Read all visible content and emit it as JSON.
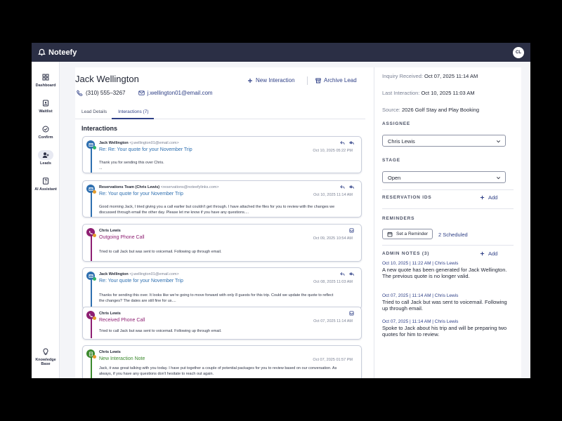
{
  "app": {
    "name": "Noteefy",
    "user_initials": "CL"
  },
  "sidebar": {
    "items": [
      {
        "label": "Dashboard",
        "icon": "grid-icon"
      },
      {
        "label": "Waitlist",
        "icon": "clipboard-icon"
      },
      {
        "label": "Confirm",
        "icon": "check-circle-icon"
      },
      {
        "label": "Leads",
        "icon": "user-plus-icon",
        "active": true
      },
      {
        "label": "AI Assistant",
        "icon": "question-book-icon"
      }
    ],
    "bottom_item": {
      "label": "Knowledge Base",
      "icon": "lightbulb-icon"
    }
  },
  "lead": {
    "name": "Jack Wellington",
    "phone": "(310) 555–3267",
    "email": "j.wellington01@email.com",
    "actions": {
      "new_interaction": "New Interaction",
      "archive_lead": "Archive Lead"
    }
  },
  "tabs": [
    {
      "label": "Lead Details",
      "active": false
    },
    {
      "label": "Interactions (7)",
      "active": true
    }
  ],
  "interactions_title": "Interactions",
  "interactions": [
    {
      "type": "email-in",
      "from_name": "Jack Wellington",
      "from_addr": "<j.wellington01@email.com>",
      "subject": "Re: Re: Your quote for your November Trip",
      "date": "Oct 10, 2025 05:22 PM",
      "body_lines": [
        "Thank you for sending this over Chris.",
        "..."
      ]
    },
    {
      "type": "email-out",
      "from_name": "Reservations Team (Chris Lewis)",
      "from_addr": "<reservations@noteefylinks.com>",
      "subject": "Re: Your quote for your November Trip",
      "date": "Oct 10, 2025 11:14 AM",
      "body_lines": [
        "Good morning Jack, I tried giving you a call earlier but couldn't get through. I have attached the files for you to review with the changes we",
        "discussed through email the other day. Please let me know if you have any questions...."
      ]
    },
    {
      "type": "call-out",
      "from_name": "Chris Lewis",
      "from_addr": "",
      "subject": "Outgoing Phone Call",
      "date": "Oct 09, 2025 10:54 AM",
      "body_lines": [
        "Tried to call Jack but was sent to voicemail. Following up through email."
      ]
    },
    {
      "type": "email-in",
      "from_name": "Jack Wellington",
      "from_addr": "<j.wellington01@email.com>",
      "subject": "Re: Your quote for your November Trip",
      "date": "Oct 08, 2025 11:03 AM",
      "body_lines": [
        "Thanks for sending this over.  It looks like we're going to move forward with only 8 guests for this trip. Could we update the quote to reflect",
        "the changes? The dates are still fine for us...."
      ]
    },
    {
      "type": "call-in",
      "from_name": "Chris Lewis",
      "from_addr": "",
      "subject": "Received Phone Call",
      "date": "Oct 07, 2025 11:14 AM",
      "body_lines": [
        "Tried to call Jack but was sent to voicemail. Following up through email."
      ]
    },
    {
      "type": "note",
      "from_name": "Chris Lewis",
      "from_addr": "",
      "subject": "New Interaction Note",
      "date": "Oct 07, 2025 01:57 PM",
      "body_lines": [
        "Jack, it was great talking with you today. I have put together a couple of potential packages for you to review based on our conversation. As",
        "always, if you have any questions don't hesitate to reach out again."
      ]
    }
  ],
  "details": {
    "inquiry_received_label": "Inquiry Received:",
    "inquiry_received": "Oct 07, 2025 11:14 AM",
    "last_interaction_label": "Last Interaction:",
    "last_interaction": "Oct 10, 2025 11:03 AM",
    "source_label": "Source:",
    "source": "2026 Golf Stay and Play Booking"
  },
  "assignee": {
    "heading": "ASSIGNEE",
    "value": "Chris Lewis"
  },
  "stage": {
    "heading": "STAGE",
    "value": "Open"
  },
  "reservation_ids": {
    "heading": "RESERVATION IDS",
    "add_label": "Add"
  },
  "reminders": {
    "heading": "REMINDERS",
    "button": "Set a Reminder",
    "scheduled": "2 Scheduled"
  },
  "admin_notes": {
    "heading": "ADMIN NOTES (3)",
    "add_label": "Add",
    "notes": [
      {
        "meta": "Oct 10, 2025 | 11:22 AM | Chris Lewis",
        "text": "A new quote has been generated for Jack Wellington. The previous quote is no longer valid."
      },
      {
        "meta": "Oct 07, 2025 | 11:14 AM | Chris Lewis",
        "text": "Tried to call Jack but was sent to voicemail. Following up through email."
      },
      {
        "meta": "Oct 07, 2025 | 11:14 AM | Chris Lewis",
        "text": "Spoke to Jack about his trip and will be preparing two quotes for him to review."
      }
    ]
  },
  "colors": {
    "email": "#2e6fb0",
    "outgoing_call": "#8e1f72",
    "received_call": "#8e1f72",
    "note": "#3c8a2e",
    "accent": "#2e3f86"
  }
}
